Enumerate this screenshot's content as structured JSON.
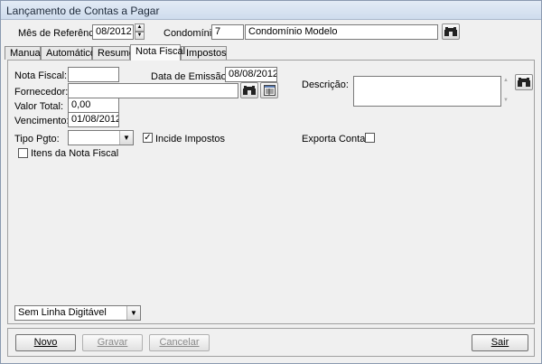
{
  "window": {
    "title": "Lançamento de Contas a Pagar"
  },
  "header": {
    "mes_label": "Mês de Referência:",
    "mes_value": "08/2012",
    "condominio_label": "Condomínio:",
    "condominio_code": "7",
    "condominio_name": "Condomínio Modelo"
  },
  "tabs": [
    {
      "label": "Manual"
    },
    {
      "label": "Automático"
    },
    {
      "label": "Resumo"
    },
    {
      "label": "Nota Fiscal",
      "active": true
    },
    {
      "label": "Impostos"
    }
  ],
  "form": {
    "nota_fiscal_label": "Nota Fiscal:",
    "nota_fiscal_value": "",
    "data_emissao_label": "Data de Emissão NF:",
    "data_emissao_value": "08/08/2012",
    "fornecedor_label": "Fornecedor:",
    "fornecedor_value": "",
    "valor_total_label": "Valor Total:",
    "valor_total_value": "0,00",
    "vencimento_label": "Vencimento:",
    "vencimento_value": "01/08/2012",
    "tipo_pgto_label": "Tipo Pgto:",
    "tipo_pgto_value": "",
    "incide_impostos_label": "Incide Impostos",
    "incide_impostos_checked": true,
    "itens_label": "Itens da Nota Fiscal",
    "itens_checked": false,
    "descricao_label": "Descrição:",
    "descricao_value": "",
    "exporta_label": "Exporta Contabil",
    "exporta_checked": false,
    "linha_digitavel_value": "Sem Linha Digitável"
  },
  "footer": {
    "novo": "Novo",
    "gravar": "Gravar",
    "cancelar": "Cancelar",
    "sair": "Sair"
  },
  "icons": {
    "search": "binoculars-icon",
    "details": "grid-detail-icon"
  }
}
